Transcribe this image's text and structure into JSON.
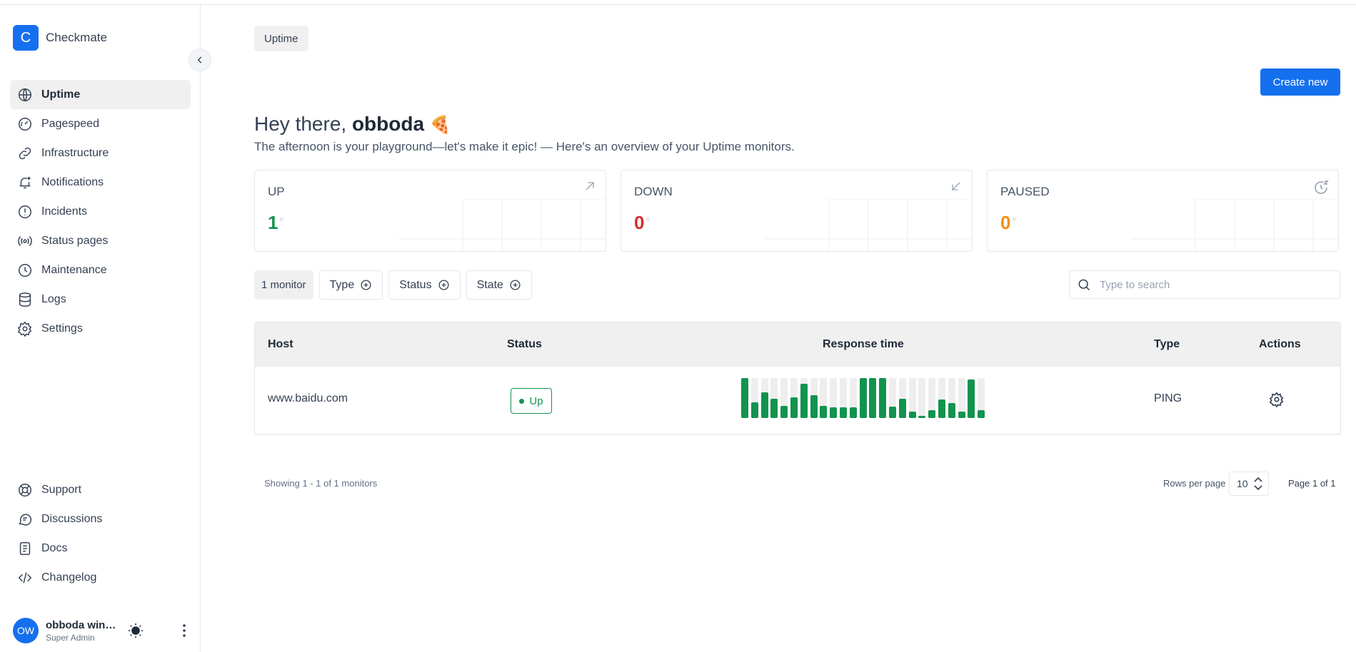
{
  "app": {
    "logo_letter": "C",
    "name": "Checkmate"
  },
  "sidebar": {
    "items": [
      {
        "label": "Uptime",
        "icon": "globe-icon",
        "active": true
      },
      {
        "label": "Pagespeed",
        "icon": "speedometer-icon"
      },
      {
        "label": "Infrastructure",
        "icon": "link-icon"
      },
      {
        "label": "Notifications",
        "icon": "bell-plus-icon"
      },
      {
        "label": "Incidents",
        "icon": "alert-circle-icon"
      },
      {
        "label": "Status pages",
        "icon": "broadcast-icon"
      },
      {
        "label": "Maintenance",
        "icon": "clock-icon"
      },
      {
        "label": "Logs",
        "icon": "database-icon"
      },
      {
        "label": "Settings",
        "icon": "gear-icon"
      }
    ],
    "bottom_items": [
      {
        "label": "Support",
        "icon": "lifebuoy-icon"
      },
      {
        "label": "Discussions",
        "icon": "chat-icon"
      },
      {
        "label": "Docs",
        "icon": "document-icon"
      },
      {
        "label": "Changelog",
        "icon": "code-icon"
      }
    ]
  },
  "user": {
    "initials": "OW",
    "name": "obboda win…",
    "role": "Super Admin"
  },
  "breadcrumb": "Uptime",
  "create_button": "Create new",
  "greeting": {
    "prefix": "Hey there, ",
    "name": "obboda",
    "emoji": "🍕"
  },
  "subtitle": "The afternoon is your playground—let's make it epic! — Here's an overview of your Uptime monitors.",
  "stats": [
    {
      "label": "UP",
      "value": "1",
      "unit": "#",
      "color": "#12934e",
      "icon": "arrow-up-right-icon"
    },
    {
      "label": "DOWN",
      "value": "0",
      "unit": "#",
      "color": "#d32f2f",
      "icon": "arrow-down-left-icon"
    },
    {
      "label": "PAUSED",
      "value": "0",
      "unit": "#",
      "color": "#f79009",
      "icon": "clock-snooze-icon"
    }
  ],
  "filters": {
    "count": "1 monitor",
    "type": "Type",
    "status": "Status",
    "state": "State"
  },
  "search": {
    "placeholder": "Type to search",
    "value": ""
  },
  "table": {
    "columns": [
      "Host",
      "Status",
      "Response time",
      "Type",
      "Actions"
    ],
    "rows": [
      {
        "host": "www.baidu.com",
        "status": "Up",
        "type": "PING",
        "response_bars": [
          1.0,
          0.4,
          0.64,
          0.48,
          0.3,
          0.52,
          0.86,
          0.58,
          0.3,
          0.26,
          0.26,
          0.26,
          1.0,
          1.0,
          1.0,
          0.28,
          0.48,
          0.16,
          0.06,
          0.2,
          0.46,
          0.38,
          0.16,
          0.96,
          0.2
        ]
      }
    ]
  },
  "footer": {
    "showing": "Showing 1 - 1 of 1 monitors",
    "rows_per_page_label": "Rows per page",
    "rows_per_page": "10",
    "page": "Page 1 of 1"
  },
  "colors": {
    "accent": "#1570ef",
    "up": "#12934e",
    "down": "#d32f2f",
    "paused": "#f79009"
  }
}
